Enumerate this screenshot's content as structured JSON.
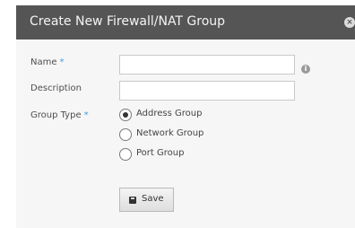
{
  "dialog": {
    "title": "Create New Firewall/NAT Group",
    "close_icon": "close-icon"
  },
  "form": {
    "name": {
      "label": "Name",
      "required_marker": "*",
      "value": "",
      "info_icon": "info-icon"
    },
    "description": {
      "label": "Description",
      "value": ""
    },
    "group_type": {
      "label": "Group Type",
      "required_marker": "*",
      "options": [
        {
          "label": "Address Group",
          "selected": true
        },
        {
          "label": "Network Group",
          "selected": false
        },
        {
          "label": "Port Group",
          "selected": false
        }
      ]
    }
  },
  "actions": {
    "save_label": "Save",
    "save_icon": "floppy-disk-icon"
  },
  "colors": {
    "titlebar": "#555555",
    "required_marker": "#4c9bd8",
    "background": "#f6f6f6"
  }
}
